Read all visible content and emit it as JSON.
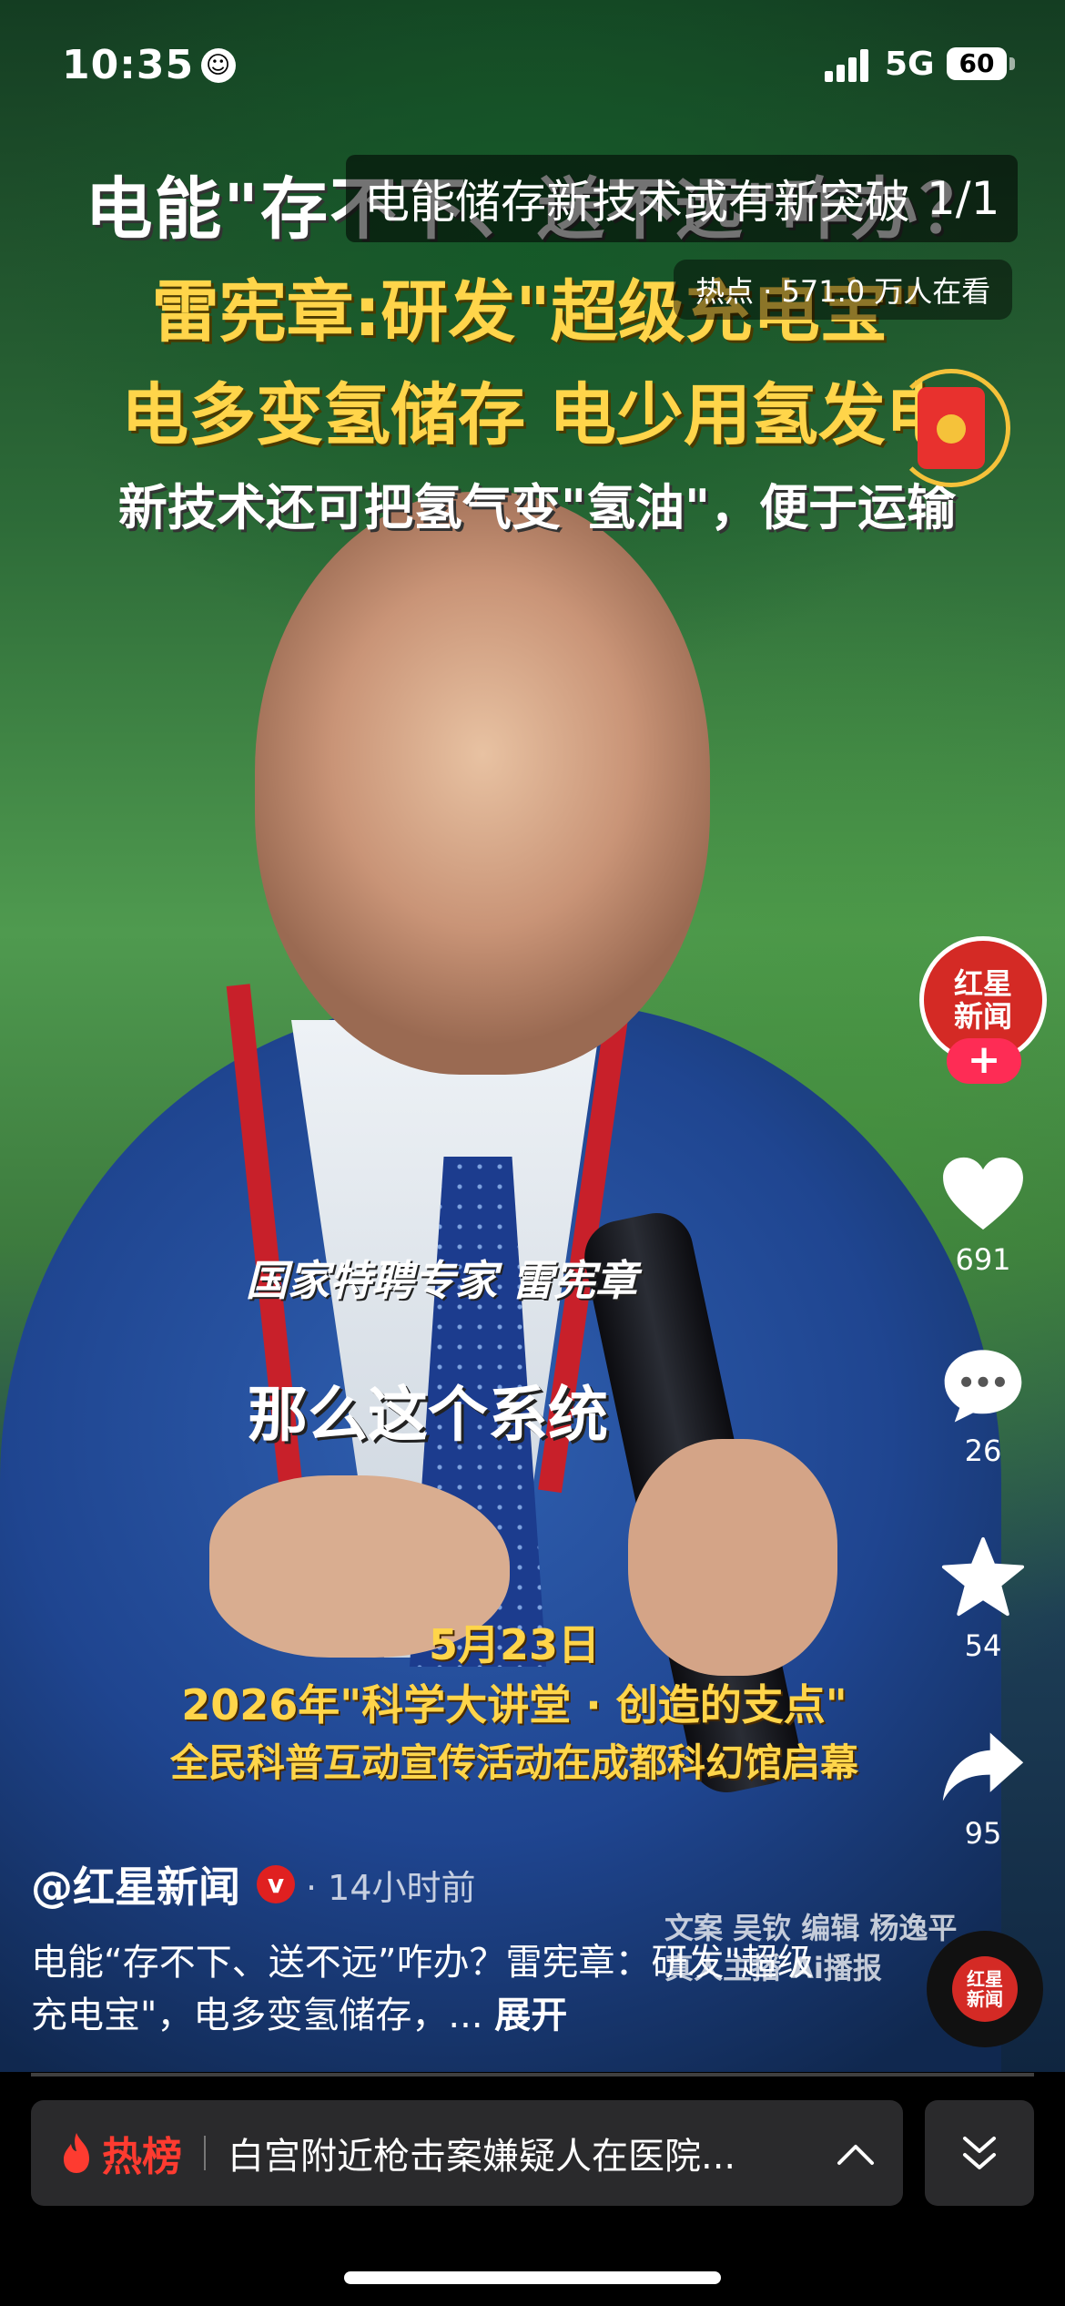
{
  "status_bar": {
    "time": "10:35",
    "network": "5G",
    "battery": "60"
  },
  "topic": {
    "title": "电能储存新技术或有新突破",
    "index": "1/1",
    "hot_label": "热点 · 571.0 万人在看"
  },
  "video_overlay": {
    "headline_1": "电能\"存不下、送不远\"咋办？",
    "headline_2": "雷宪章:研发\"超级充电宝\"",
    "headline_3": "电多变氢储存  电少用氢发电",
    "headline_4": "新技术还可把氢气变\"氢油\"，便于运输",
    "speaker_caption": "国家特聘专家 雷宪章",
    "subtitle": "那么这个系统",
    "event_date": "5月23日",
    "event_name": "2026年\"科学大讲堂 · 创造的支点\"",
    "event_desc": "全民科普互动宣传活动在成都科幻馆启幕",
    "credits_1": "文案 吴钦 编辑 杨逸平",
    "credits_2": "真人主播 Ai播报"
  },
  "rail": {
    "avatar_line1": "红星",
    "avatar_line2": "新闻",
    "follow_label": "+",
    "likes": "691",
    "comments": "26",
    "favorites": "54",
    "shares": "95"
  },
  "post": {
    "author": "@红星新闻",
    "verified": "v",
    "time_ago": "· 14小时前",
    "description": "电能“存不下、送不远”咋办？雷宪章：研发\"超级充电宝\"，电多变氢储存，...",
    "expand_label": "展开"
  },
  "hot_list": {
    "label": "热榜",
    "headline": "白宫附近枪击案嫌疑人在医院..."
  },
  "colors": {
    "accent_red": "#fe2c55",
    "hot_red": "#fe3b30",
    "caption_yellow": "#ffd54a"
  }
}
